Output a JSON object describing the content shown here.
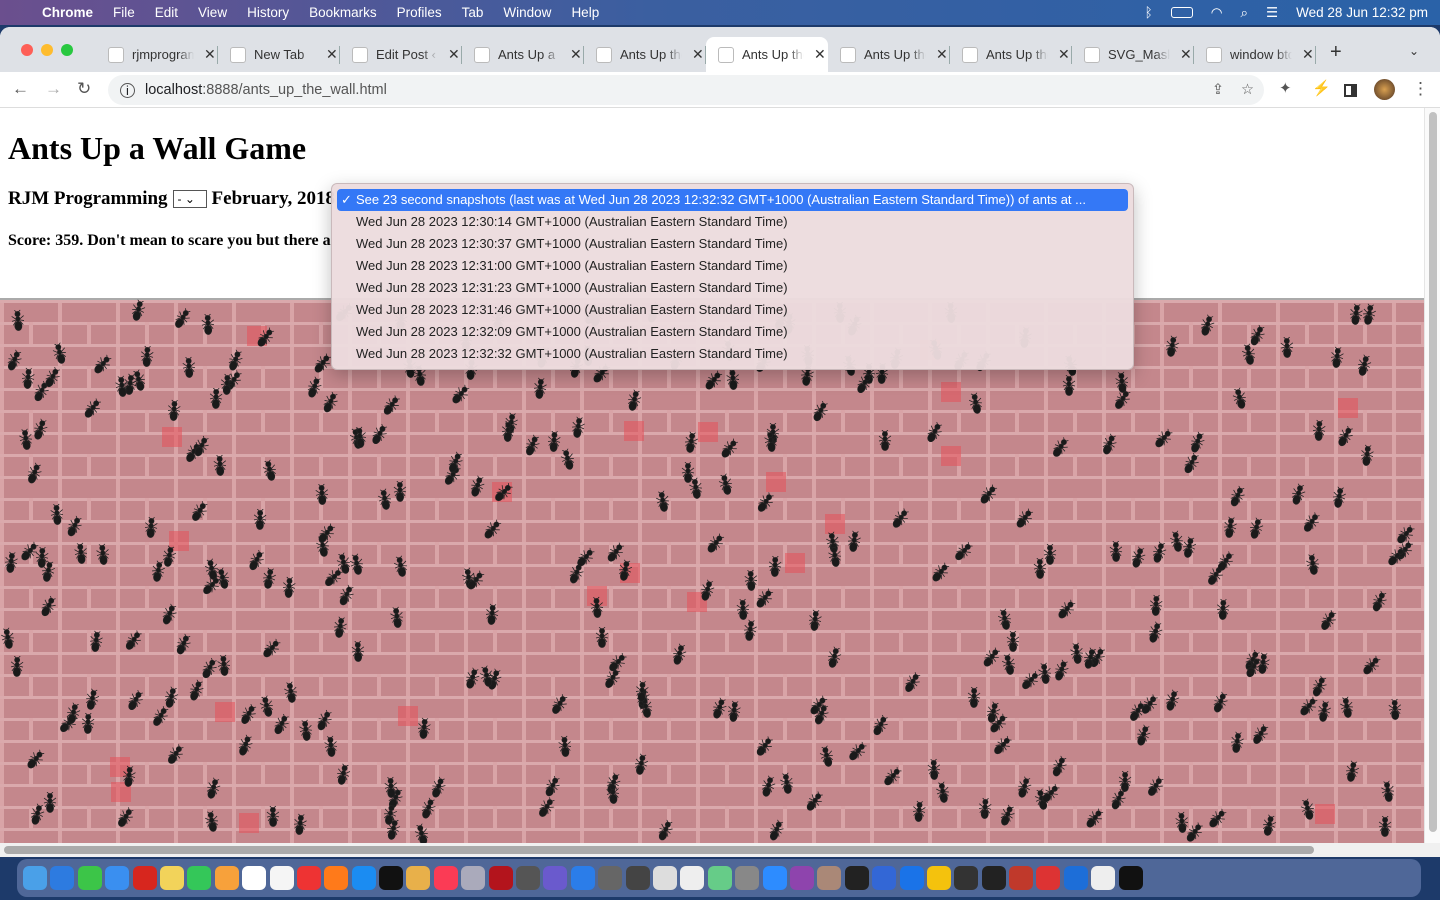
{
  "menubar": {
    "app": "Chrome",
    "items": [
      "File",
      "Edit",
      "View",
      "History",
      "Bookmarks",
      "Profiles",
      "Tab",
      "Window",
      "Help"
    ],
    "clock": "Wed 28 Jun  12:32 pm"
  },
  "tabs": [
    {
      "title": "rjmprogramming",
      "active": false
    },
    {
      "title": "New Tab",
      "active": false
    },
    {
      "title": "Edit Post ‹",
      "active": false
    },
    {
      "title": "Ants Up a",
      "active": false
    },
    {
      "title": "Ants Up the",
      "active": false
    },
    {
      "title": "Ants Up the",
      "active": true
    },
    {
      "title": "Ants Up the",
      "active": false
    },
    {
      "title": "Ants Up the",
      "active": false
    },
    {
      "title": "SVG_Mask",
      "active": false
    },
    {
      "title": "window btoa",
      "active": false
    }
  ],
  "address": {
    "host": "localhost",
    "rest": ":8888/ants_up_the_wall.html"
  },
  "page": {
    "title": "Ants Up a Wall Game",
    "brand": "RJM Programming",
    "mini_select": "-",
    "date": "February, 2018",
    "score_text": "Score: 359. Don't mean to scare you but there a"
  },
  "dropdown": {
    "selected": "See 23 second snapshots (last was at Wed Jun 28 2023 12:32:32 GMT+1000 (Australian Eastern Standard Time)) of ants at ...",
    "options": [
      "Wed Jun 28 2023 12:30:14 GMT+1000 (Australian Eastern Standard Time)",
      "Wed Jun 28 2023 12:30:37 GMT+1000 (Australian Eastern Standard Time)",
      "Wed Jun 28 2023 12:31:00 GMT+1000 (Australian Eastern Standard Time)",
      "Wed Jun 28 2023 12:31:23 GMT+1000 (Australian Eastern Standard Time)",
      "Wed Jun 28 2023 12:31:46 GMT+1000 (Australian Eastern Standard Time)",
      "Wed Jun 28 2023 12:32:09 GMT+1000 (Australian Eastern Standard Time)",
      "Wed Jun 28 2023 12:32:32 GMT+1000 (Australian Eastern Standard Time)"
    ]
  },
  "dock_colors": [
    "#4aa0e8",
    "#2d7be0",
    "#3cc548",
    "#3a8ff0",
    "#d7261e",
    "#f2d35a",
    "#34c759",
    "#f7a13b",
    "#ffffff",
    "#f5f5f5",
    "#e33",
    "#ff7a1a",
    "#1b8cf2",
    "#111",
    "#e8b04a",
    "#fb3b55",
    "#aab",
    "#b3141c",
    "#555",
    "#6a5acd",
    "#2b7de9",
    "#666",
    "#444",
    "#ddd",
    "#eee",
    "#6c8",
    "#888",
    "#2d8cff",
    "#8e44ad",
    "#a87",
    "#222",
    "#3367d6",
    "#1a73e8",
    "#f4c20d",
    "#333",
    "#222",
    "#c0392b",
    "#d33",
    "#1d6ed8",
    "#eee",
    "#111"
  ],
  "colors": {
    "wall": "#c4878c",
    "selection": "#3478f6"
  }
}
